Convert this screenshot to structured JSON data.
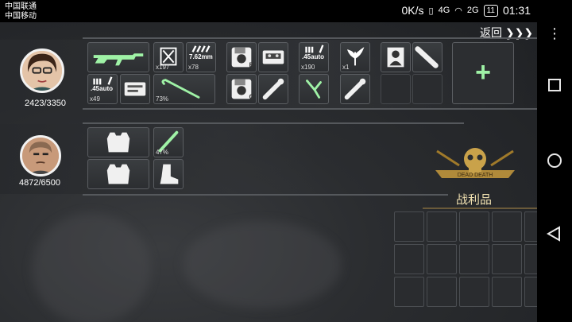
{
  "status_bar": {
    "carrier_1": "中国联通",
    "carrier_2": "中国移动",
    "net_speed": "0K/s",
    "signal_1": "4G",
    "signal_2": "2G",
    "battery": "11",
    "time": "01:31"
  },
  "header": {
    "back_label": "返回 ❯❯❯"
  },
  "characters": [
    {
      "hp": "2423/3350",
      "slots": {
        "qty_rifle_ammo": "x197",
        "ammo_762": "7.62mm",
        "qty_762": "x78",
        "ammo_45_top": ".45auto",
        "qty_45_top": "x190",
        "qty_herb": "x1",
        "ammo_45_bottom": ".45auto",
        "qty_45_bottom": "x49",
        "crowbar_durability": "73%"
      }
    },
    {
      "hp": "4872/6500",
      "slots": {
        "knife_durability": "47%"
      }
    }
  ],
  "add_slot": {
    "symbol": "+"
  },
  "loot": {
    "title": "战利品",
    "emblem_text": "DEAD DEATH"
  },
  "colors": {
    "accent_green": "#9ff2a6",
    "panel": "#2c2e31",
    "gold": "#c9a24a"
  }
}
